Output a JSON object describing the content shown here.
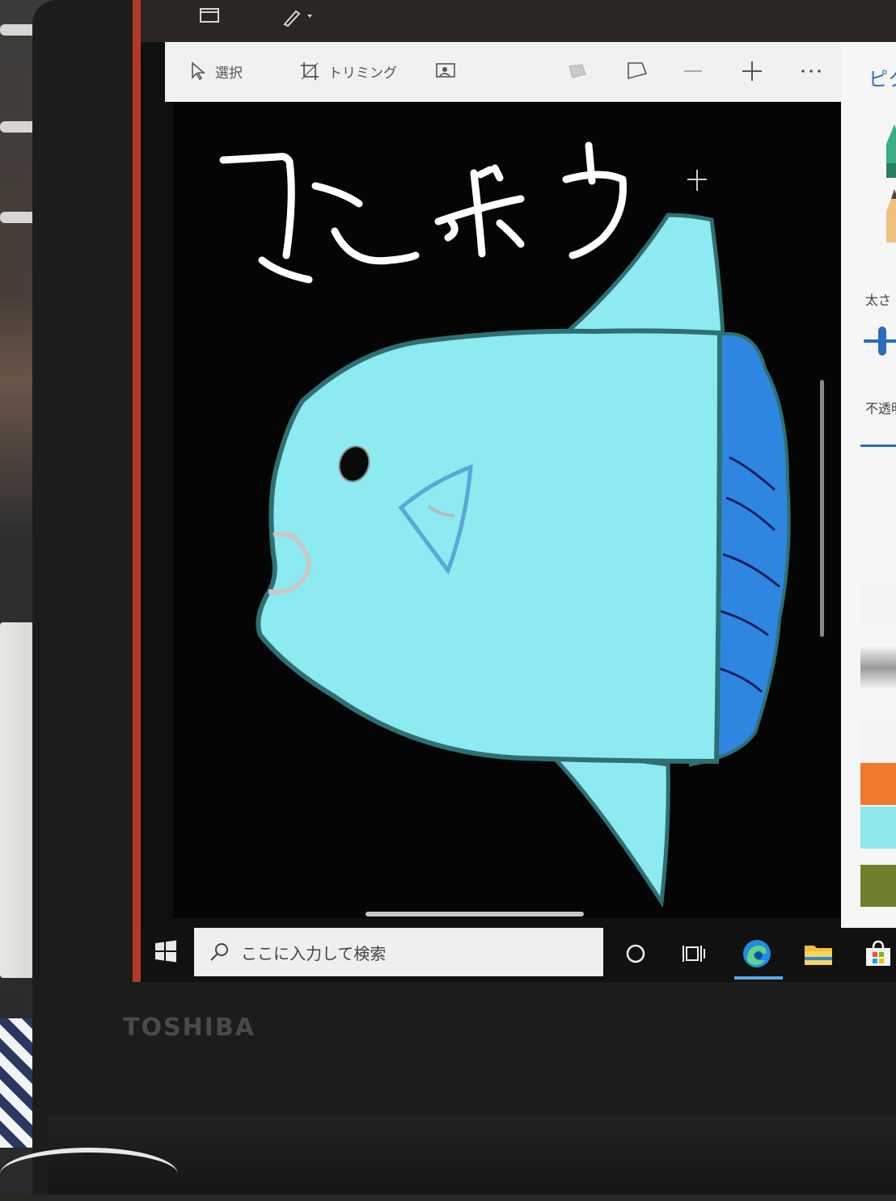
{
  "app": {
    "toolbar": {
      "select_label": "選択",
      "crop_label": "トリミング"
    },
    "canvas": {
      "drawing_title": "マンボウ",
      "colors": {
        "background": "#050505",
        "body": "#8ceaf0",
        "outline": "#2f6f72",
        "back_fin": "#2f86e0",
        "fin_stripes": "#12205a",
        "title_stroke": "#ffffff"
      }
    },
    "side_panel": {
      "title": "ピク",
      "thickness_label": "太さ",
      "opacity_label": "不透明",
      "swatches": [
        "#f4f4f4",
        "#e3e3e3",
        "#f3f3f3",
        "#f07a2a",
        "#8ee8ec",
        "#6e7f2e"
      ]
    }
  },
  "taskbar": {
    "search_placeholder": "ここに入力して検索",
    "icons": [
      "windows-start-icon",
      "cortana-icon",
      "task-view-icon",
      "edge-icon",
      "file-explorer-icon",
      "store-icon"
    ]
  },
  "device": {
    "brand": "TOSHIBA"
  }
}
